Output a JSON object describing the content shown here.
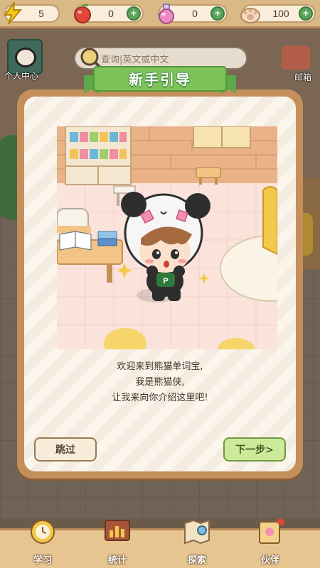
{
  "resources": {
    "energy": "5",
    "apple": "0",
    "potion": "0",
    "paw": "100"
  },
  "header": {
    "profile_label": "个人中心",
    "search_placeholder": "查询|英文或中文",
    "mail_label": "邮箱"
  },
  "modal": {
    "title": "新手引导",
    "lines": [
      "欢迎来到熊猫单词宝,",
      "我是熊猫侠,",
      "让我来向你介绍这里吧!"
    ],
    "skip_label": "跳过",
    "next_label": "下一步>"
  },
  "nav": {
    "study": "学习",
    "stats": "统计",
    "explore": "探索",
    "partner": "伙伴"
  },
  "colors": {
    "accent_green": "#7cc35a",
    "frame_brown": "#c48f5a",
    "next_button": "#cdea9a"
  },
  "icons": {
    "energy": "lightning-icon",
    "apple": "apple-icon",
    "potion": "potion-icon",
    "paw": "paw-icon",
    "search": "magnifier-icon"
  }
}
